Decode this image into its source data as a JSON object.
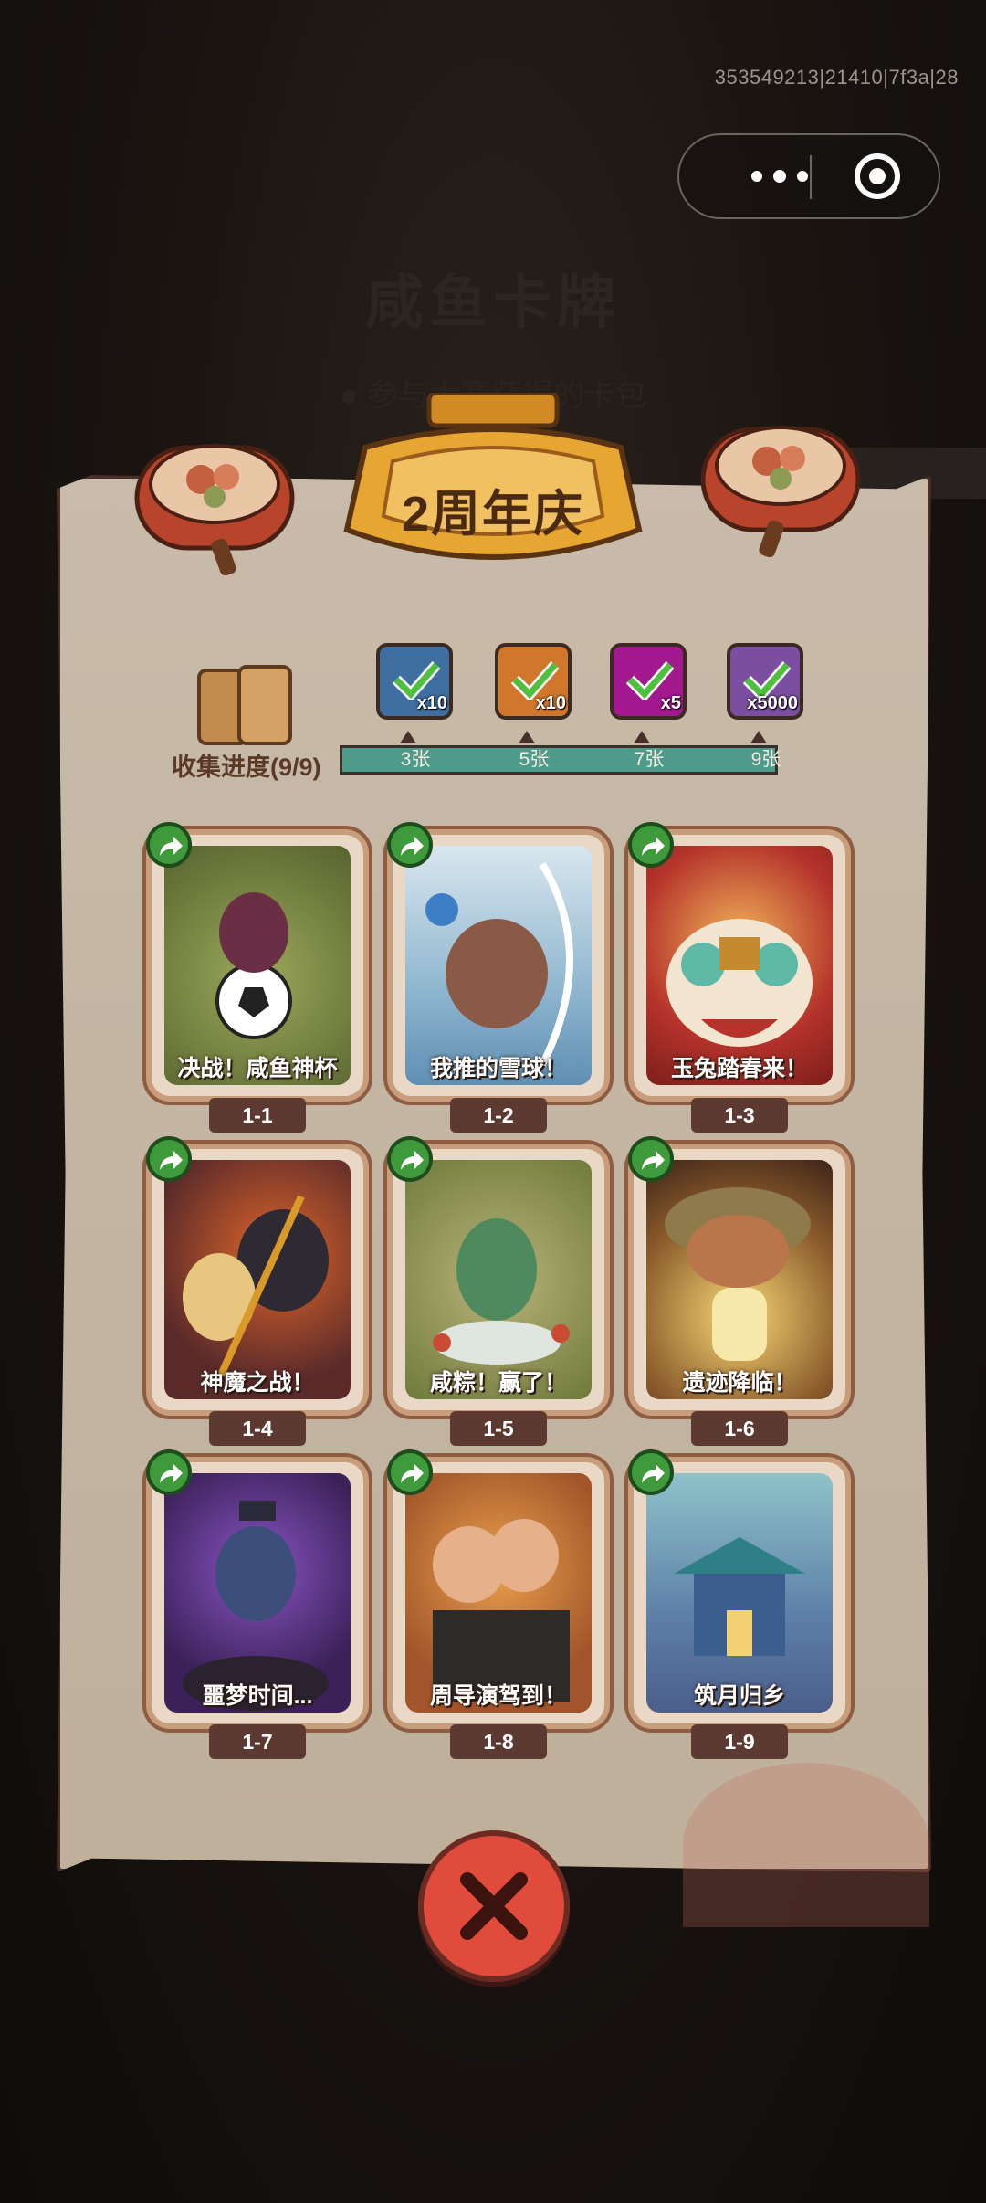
{
  "debug_text": "353549213|21410|7f3a|28",
  "capsule": {
    "more_icon": "more-dots-icon",
    "target_icon": "target-circle-icon"
  },
  "background": {
    "title": "咸鱼卡牌",
    "subtitle": "● 参与大赛获得的卡包"
  },
  "event": {
    "title": "2周年庆"
  },
  "collection": {
    "label": "收集进度(9/9)",
    "milestones": [
      "3张",
      "5张",
      "7张",
      "9张"
    ],
    "rewards": [
      {
        "icon": "chest-reward-icon",
        "count": "x10",
        "color": "#3e6fa0"
      },
      {
        "icon": "ticket-reward-icon",
        "count": "x10",
        "color": "#d0772b"
      },
      {
        "icon": "gem-reward-icon",
        "count": "x5",
        "color": "#a3198f"
      },
      {
        "icon": "crystal-reward-icon",
        "count": "x5000",
        "color": "#7b4ea1"
      }
    ]
  },
  "cards": [
    {
      "title": "决战！咸鱼神杯",
      "id": "1-1"
    },
    {
      "title": "我推的雪球！",
      "id": "1-2"
    },
    {
      "title": "玉兔踏春来！",
      "id": "1-3"
    },
    {
      "title": "神魔之战！",
      "id": "1-4"
    },
    {
      "title": "咸粽！赢了！",
      "id": "1-5"
    },
    {
      "title": "遗迹降临！",
      "id": "1-6"
    },
    {
      "title": "噩梦时间...",
      "id": "1-7"
    },
    {
      "title": "周导演驾到！",
      "id": "1-8"
    },
    {
      "title": "筑月归乡",
      "id": "1-9"
    }
  ],
  "colors": {
    "accent": "#3f9a3c",
    "close": "#e14b3b",
    "bar": "#4e9a8b"
  }
}
